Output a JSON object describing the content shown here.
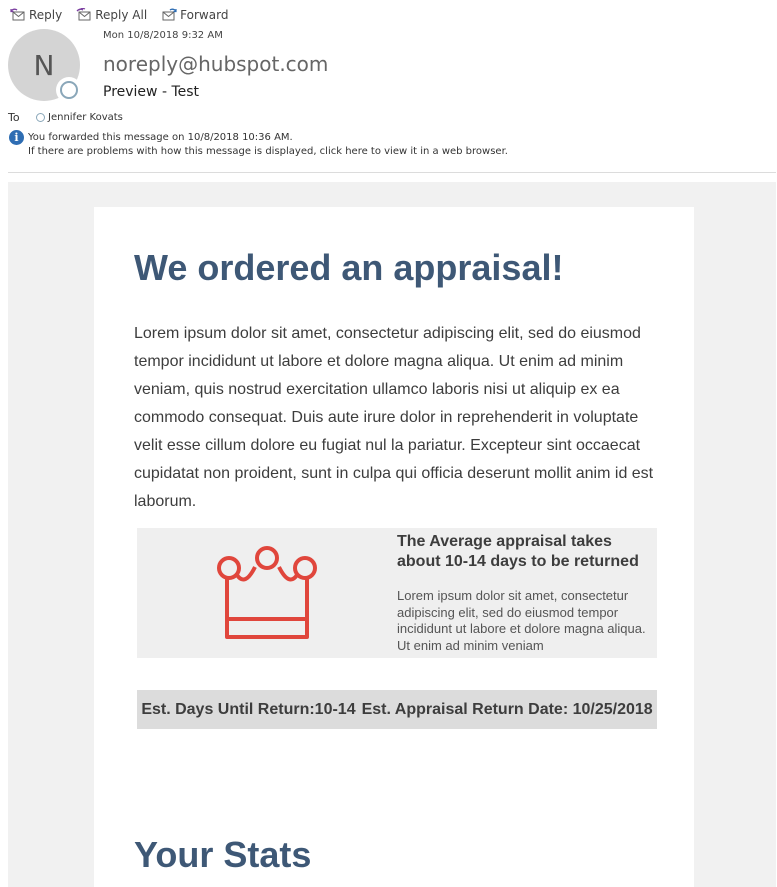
{
  "toolbar": {
    "reply": "Reply",
    "reply_all": "Reply All",
    "forward": "Forward"
  },
  "message": {
    "avatar_initial": "N",
    "date": "Mon 10/8/2018 9:32 AM",
    "sender": "noreply@hubspot.com",
    "subject": "Preview - Test",
    "to_label": "To",
    "to_name": "Jennifer Kovats",
    "info_line1": "You forwarded this message on 10/8/2018 10:36 AM.",
    "info_line2": "If there are problems with how this message is displayed, click here to view it in a web browser."
  },
  "email": {
    "title": "We ordered an appraisal!",
    "paragraph": "Lorem ipsum dolor sit amet, consectetur adipiscing elit, sed do eiusmod tempor incididunt ut labore et dolore magna aliqua. Ut enim ad minim veniam, quis nostrud exercitation ullamco laboris nisi ut aliquip ex ea commodo consequat. Duis aute irure dolor in reprehenderit in voluptate velit esse cillum dolore eu fugiat nul la pariatur. Excepteur sint occaecat cupidatat non proident, sunt in culpa qui officia deserunt mollit anim id est laborum.",
    "feature_title": "The Average appraisal takes about 10-14 days to be returned",
    "feature_text": "Lorem ipsum dolor sit amet, consectetur adipiscing elit, sed do eiusmod tempor incididunt ut labore et dolore magna aliqua. Ut enim ad minim veniam",
    "days_label": "Est. Days Until Return:10-14",
    "return_date_label": "Est. Appraisal Return Date: 10/25/2018",
    "stats_heading": "Your Stats"
  },
  "icons": {
    "reply": "reply-icon",
    "reply_all": "reply-all-icon",
    "forward": "forward-icon",
    "info": "info-icon",
    "crown": "crown-icon"
  },
  "colors": {
    "heading": "#3e5876",
    "crown": "#e0463c",
    "email_bg": "#f1f1f1",
    "feature_bg": "#efefef",
    "stats_bar_bg": "#dcdcdc",
    "info_icon": "#2e6db3"
  }
}
